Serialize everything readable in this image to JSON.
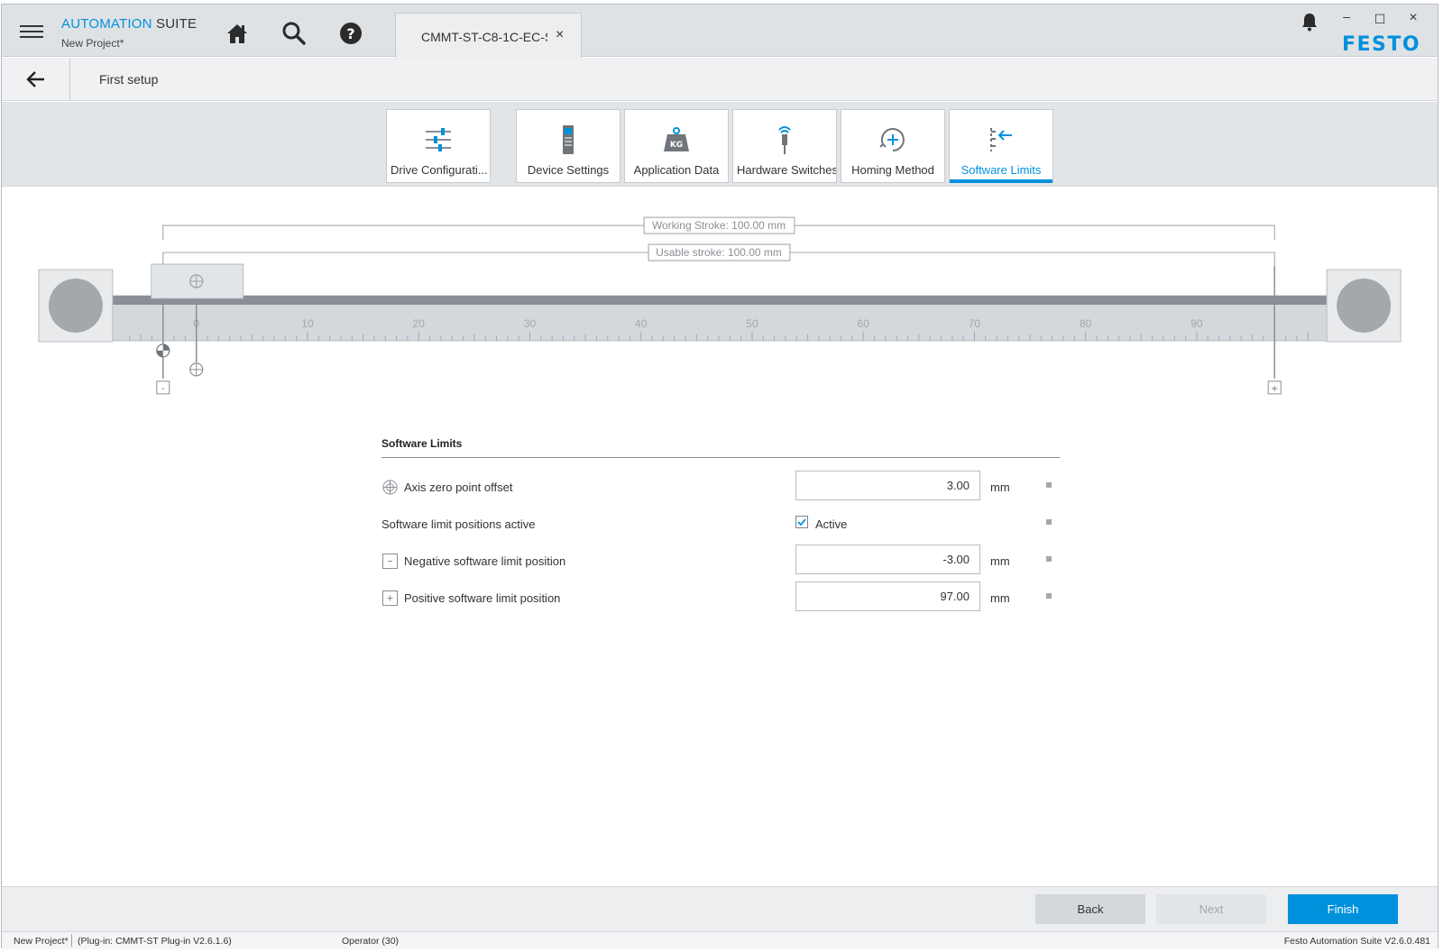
{
  "app": {
    "brand_part1": "AUTOMATION",
    "brand_part2": "SUITE",
    "project": "New Project*",
    "logo": "FESTO"
  },
  "toolbar": {
    "home_icon": "home-icon",
    "search_icon": "search-icon",
    "help_icon": "help-icon"
  },
  "document_tab": {
    "label": "CMMT-ST-C8-1C-EC-S",
    "close": "×"
  },
  "window_controls": {
    "minimize": "–",
    "maximize": "☐",
    "close": "×"
  },
  "breadcrumb": {
    "title": "First setup"
  },
  "wizard_tabs": [
    {
      "label": "Drive Configurati...",
      "icon": "sliders-icon"
    },
    {
      "label": "Device Settings",
      "icon": "device-icon"
    },
    {
      "label": "Application Data",
      "icon": "weight-kg-icon"
    },
    {
      "label": "Hardware Switches",
      "icon": "sensor-icon"
    },
    {
      "label": "Homing Method",
      "icon": "homing-icon"
    },
    {
      "label": "Software Limits",
      "icon": "software-limits-icon",
      "active": true
    }
  ],
  "axis": {
    "working_stroke": "Working Stroke: 100.00 mm",
    "usable_stroke": "Usable stroke: 100.00 mm",
    "scale_ticks": [
      "0",
      "10",
      "20",
      "30",
      "40",
      "50",
      "60",
      "70",
      "80",
      "90"
    ],
    "minus_marker": "-",
    "plus_marker": "+"
  },
  "form": {
    "title": "Software Limits",
    "rows": {
      "zero_offset": {
        "label": "Axis zero point offset",
        "value": "3.00",
        "unit": "mm"
      },
      "limits_active": {
        "label": "Software limit positions active",
        "checked": true,
        "check_label": "Active"
      },
      "negative_limit": {
        "label": "Negative software limit position",
        "value": "-3.00",
        "unit": "mm"
      },
      "positive_limit": {
        "label": "Positive software limit position",
        "value": "97.00",
        "unit": "mm"
      }
    }
  },
  "footer": {
    "back": "Back",
    "next": "Next",
    "finish": "Finish"
  },
  "status": {
    "project": "New Project*",
    "plugin": "(Plug-in: CMMT-ST Plug-in V2.6.1.6)",
    "role": "Operator (30)",
    "version": "Festo Automation Suite V2.6.0.481"
  },
  "colors": {
    "accent": "#0091dc",
    "active_tab_underline": "#0091dc"
  }
}
